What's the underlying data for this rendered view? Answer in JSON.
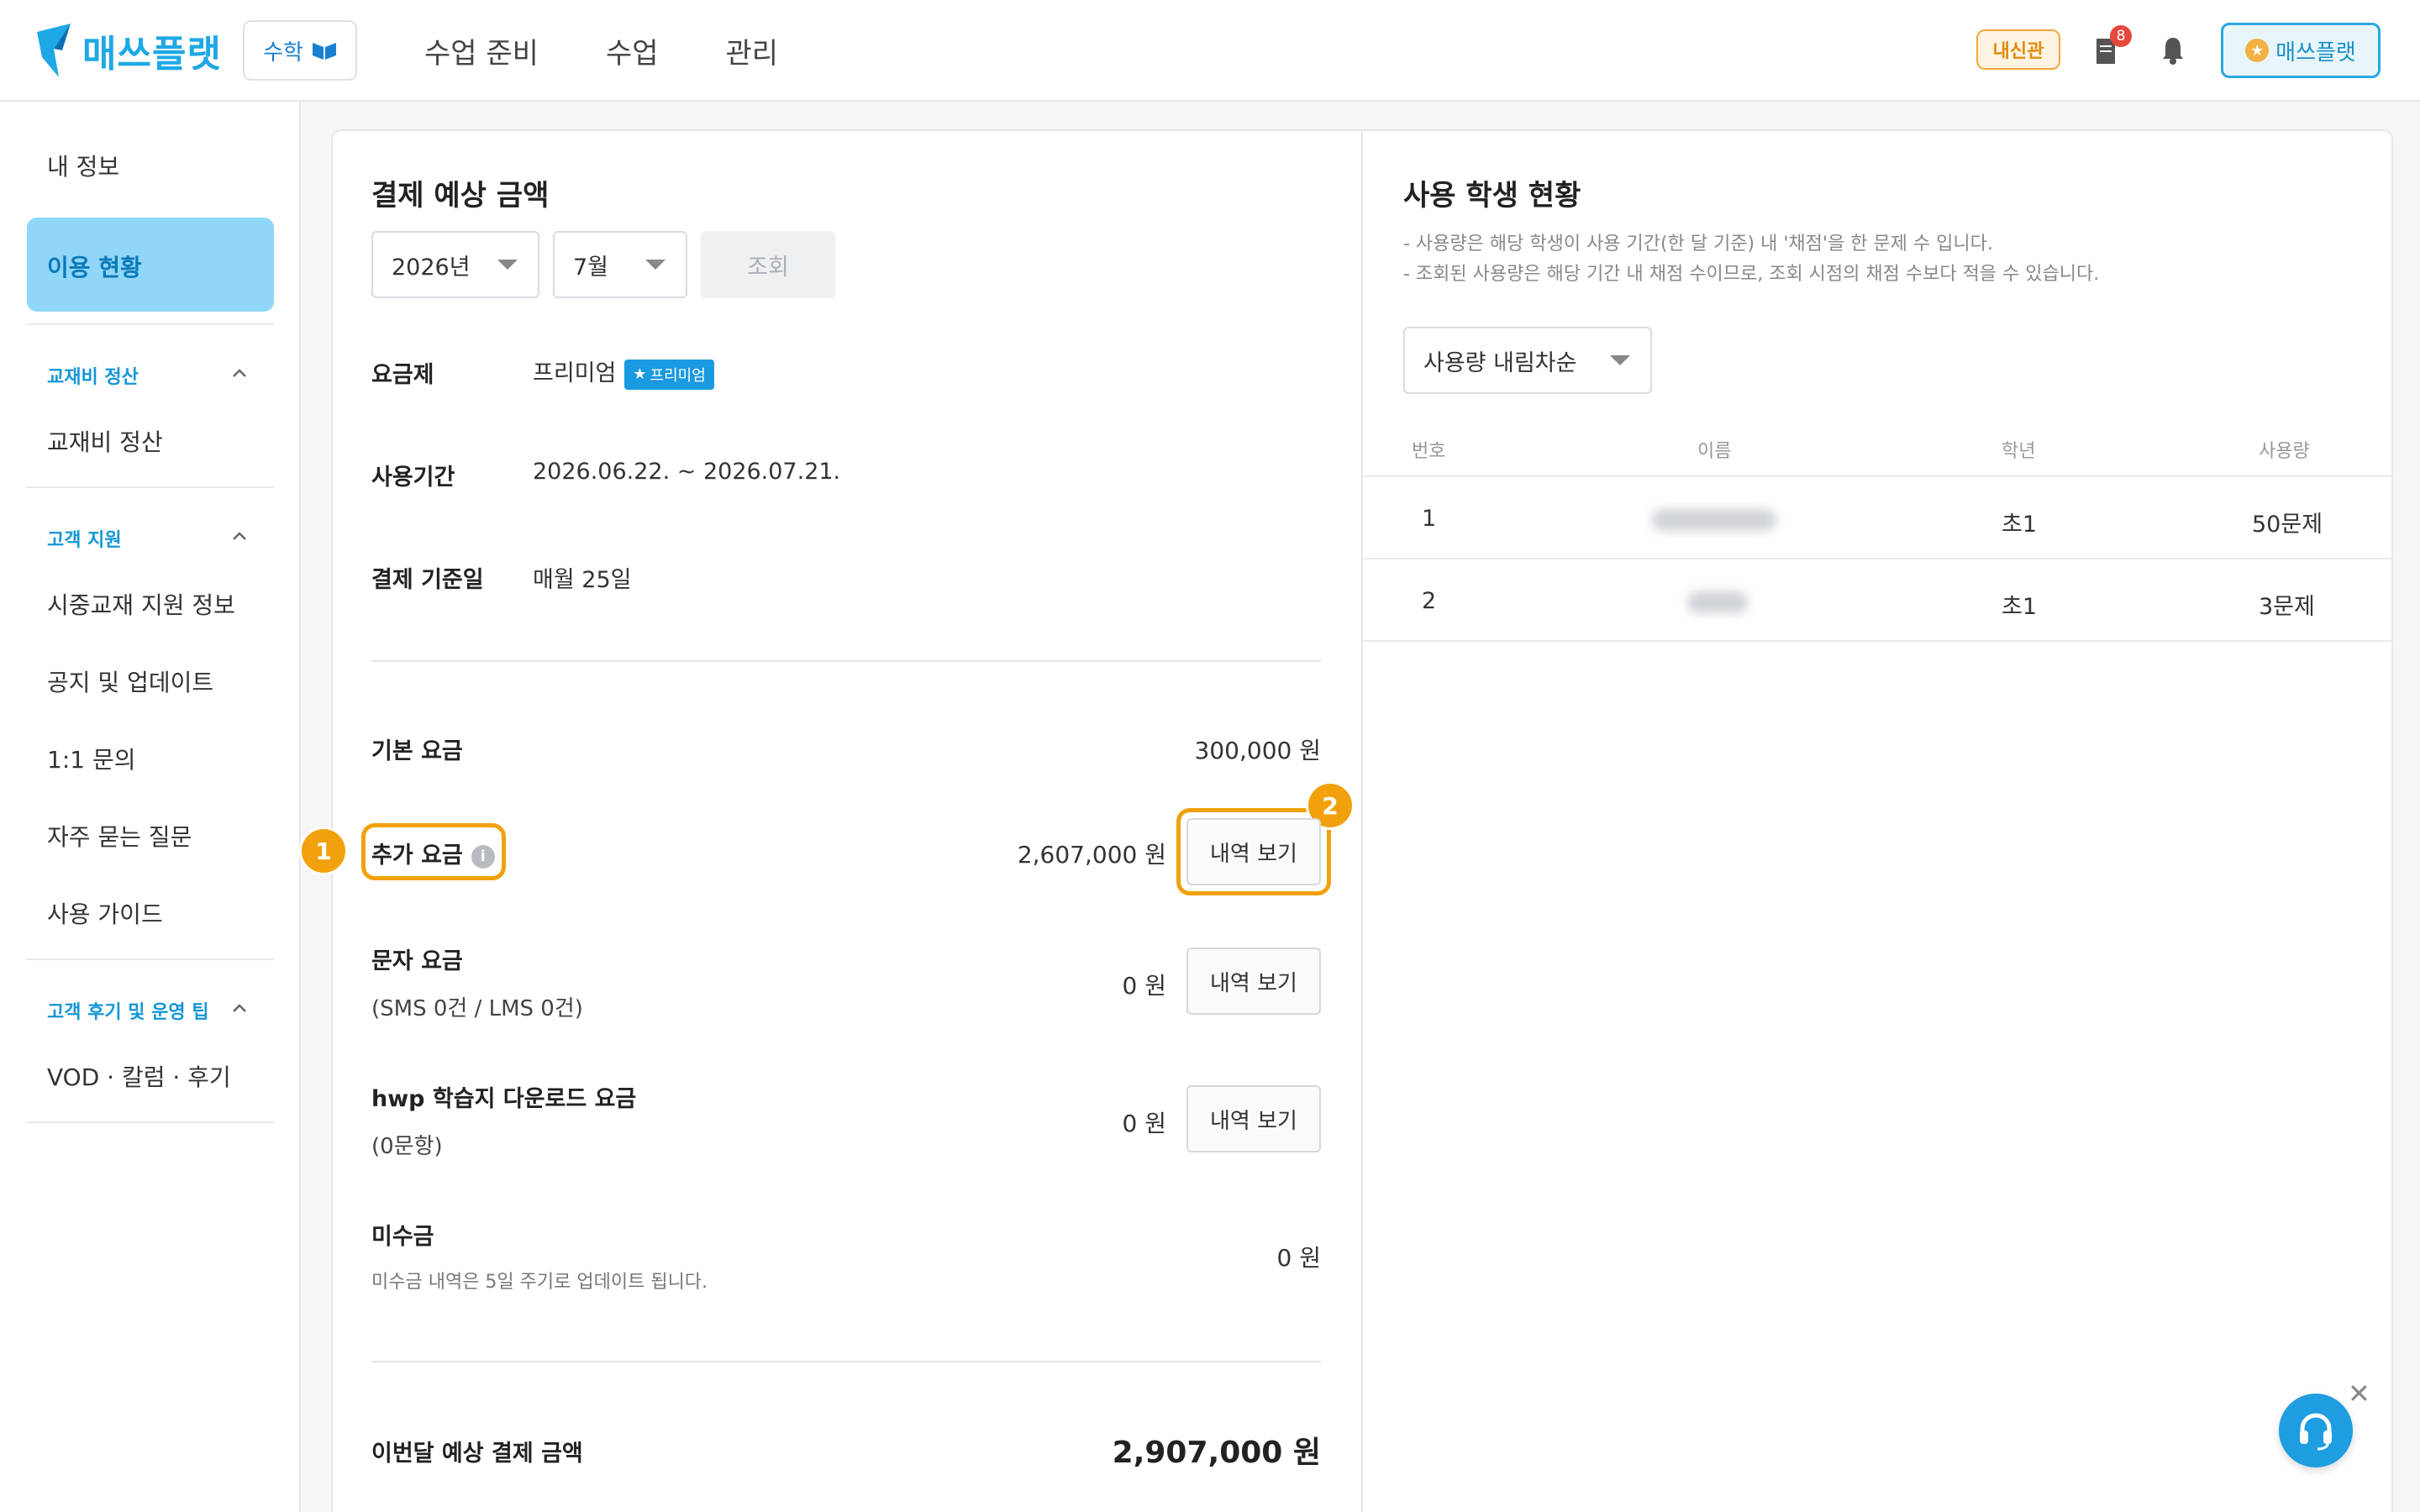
{
  "header": {
    "logo_text": "매쓰플랫",
    "subject": "수학",
    "nav": [
      "수업 준비",
      "수업",
      "관리"
    ],
    "naesin_badge": "내신관",
    "notes_count": "8",
    "brand_button": "매쓰플랫",
    "icons": [
      "document-icon",
      "bell-icon"
    ]
  },
  "sidebar": {
    "my_info": "내 정보",
    "usage": "이용 현황",
    "section_textbook": "교재비 정산",
    "textbook_settle": "교재비 정산",
    "section_support": "고객 지원",
    "support_items": [
      "시중교재 지원 정보",
      "공지 및 업데이트",
      "1:1 문의",
      "자주 묻는 질문",
      "사용 가이드"
    ],
    "section_reviews": "고객 후기 및 운영 팁",
    "reviews_item": "VOD · 칼럼 · 후기"
  },
  "payment": {
    "title": "결제 예상 금액",
    "year_select": "2026년",
    "month_select": "7월",
    "search_button": "조회",
    "plan_label": "요금제",
    "plan_value": "프리미엄",
    "plan_badge": "프리미엄",
    "period_label": "사용기간",
    "period_value": "2026.06.22. ~ 2026.07.21.",
    "billing_label": "결제 기준일",
    "billing_value": "매월 25일",
    "base_fee_label": "기본 요금",
    "base_fee_value": "300,000 원",
    "extra_fee_label": "추가 요금",
    "extra_fee_value": "2,607,000 원",
    "sms_fee_label": "문자 요금",
    "sms_fee_sub": "(SMS 0건 / LMS 0건)",
    "sms_fee_value": "0 원",
    "hwp_fee_label": "hwp 학습지 다운로드 요금",
    "hwp_fee_sub": "(0문항)",
    "hwp_fee_value": "0 원",
    "unpaid_label": "미수금",
    "unpaid_note": "미수금 내역은 5일 주기로 업데이트 됩니다.",
    "unpaid_value": "0 원",
    "total_label": "이번달 예상 결제 금액",
    "total_value": "2,907,000 원",
    "detail_button": "내역 보기",
    "highlight_1": "1",
    "highlight_2": "2"
  },
  "students": {
    "title": "사용 학생 현황",
    "desc1": "- 사용량은 해당 학생이 사용 기간(한 달 기준) 내 '채점'을 한 문제 수 입니다.",
    "desc2": "- 조회된 사용량은 해당 기간 내 채점 수이므로, 조회 시점의 채점 수보다 적을 수 있습니다.",
    "sort_select": "사용량 내림차순",
    "columns": [
      "번호",
      "이름",
      "학년",
      "사용량"
    ],
    "rows": [
      {
        "no": "1",
        "grade": "초1",
        "usage": "50문제"
      },
      {
        "no": "2",
        "grade": "초1",
        "usage": "3문제"
      }
    ]
  },
  "colors": {
    "accent": "#1ea8e6",
    "highlight": "#f1a10c",
    "active_bg": "#8fd6f8"
  }
}
